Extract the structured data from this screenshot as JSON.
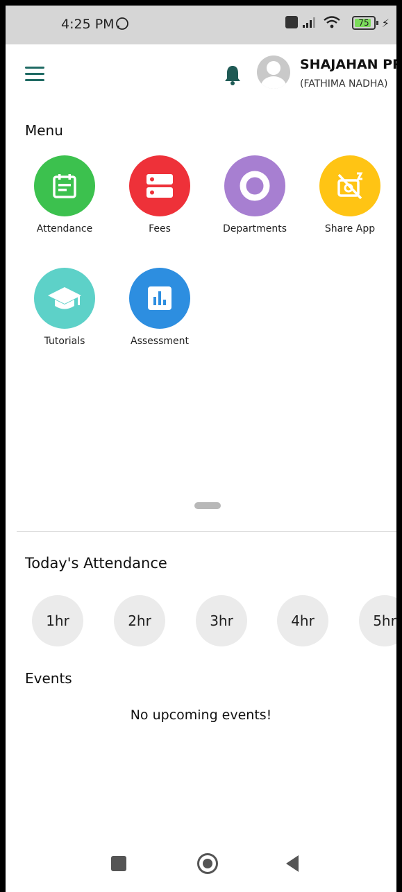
{
  "status_bar": {
    "time": "4:25 PM",
    "battery": "75"
  },
  "header": {
    "user_name": "SHAJAHAN PP",
    "user_sub": "(FATHIMA NADHA)"
  },
  "menu": {
    "title": "Menu",
    "items": [
      {
        "label": "Attendance",
        "color": "#3cc14e",
        "icon": "calendar-icon"
      },
      {
        "label": "Fees",
        "color": "#ee3139",
        "icon": "server-icon"
      },
      {
        "label": "Departments",
        "color": "#a77fd1",
        "icon": "ring-icon"
      },
      {
        "label": "Share App",
        "color": "#ffc414",
        "icon": "share-camera-icon"
      },
      {
        "label": "Tutorials",
        "color": "#5dd1c8",
        "icon": "graduation-cap-icon"
      },
      {
        "label": "Assessment",
        "color": "#2d8ee0",
        "icon": "bar-chart-icon"
      }
    ]
  },
  "attendance": {
    "title": "Today's Attendance",
    "hours": [
      "1hr",
      "2hr",
      "3hr",
      "4hr",
      "5hr"
    ]
  },
  "events": {
    "title": "Events",
    "empty_text": "No upcoming events!"
  },
  "accent_color": "#1f6a63"
}
